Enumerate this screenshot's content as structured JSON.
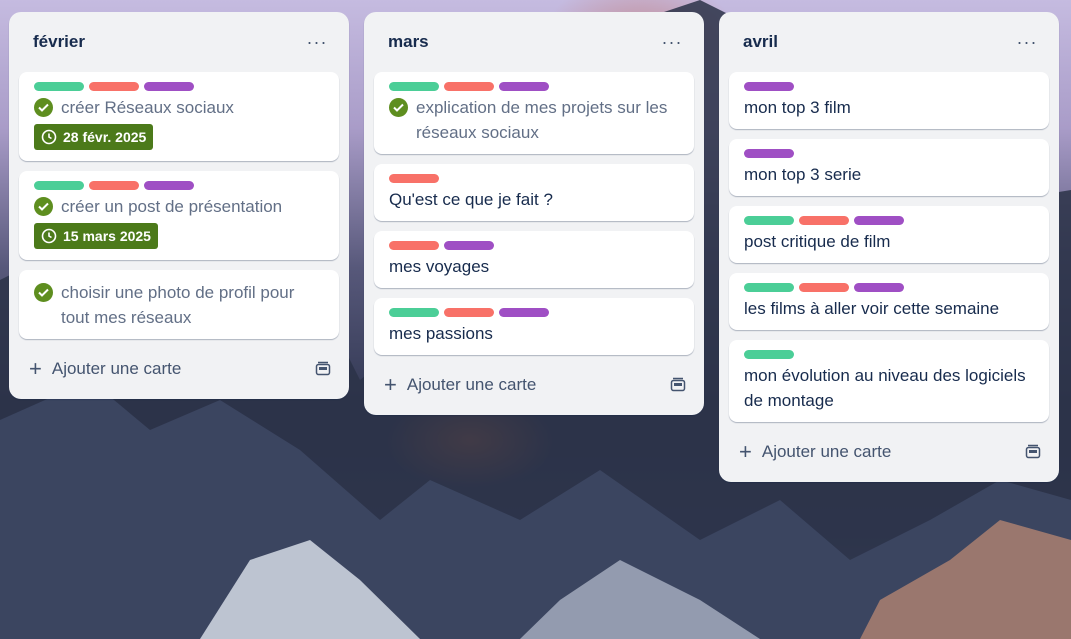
{
  "colors": {
    "green": "#4bce97",
    "red": "#f87168",
    "purple": "#9f4fc4",
    "due_bg": "#4c7a1a",
    "check_bg": "#5e8e1f"
  },
  "board": {
    "lists": [
      {
        "title": "février",
        "more_icon": "ellipsis-icon",
        "add_label": "Ajouter une carte",
        "cards": [
          {
            "labels": [
              "green",
              "red",
              "purple"
            ],
            "done": true,
            "title": "créer Réseaux sociaux",
            "due": "28 févr. 2025"
          },
          {
            "labels": [
              "green",
              "red",
              "purple"
            ],
            "done": true,
            "title": "créer un post de présentation",
            "due": "15 mars 2025"
          },
          {
            "labels": [],
            "done": true,
            "title": "choisir une photo de profil pour tout mes réseaux"
          }
        ]
      },
      {
        "title": "mars",
        "more_icon": "ellipsis-icon",
        "add_label": "Ajouter une carte",
        "cards": [
          {
            "labels": [
              "green",
              "red",
              "purple"
            ],
            "done": true,
            "title": "explication de mes projets sur les réseaux sociaux"
          },
          {
            "labels": [
              "red"
            ],
            "title": "Qu'est ce que je fait ?"
          },
          {
            "labels": [
              "red",
              "purple"
            ],
            "title": "mes voyages"
          },
          {
            "labels": [
              "green",
              "red",
              "purple"
            ],
            "title": "mes passions"
          }
        ]
      },
      {
        "title": "avril",
        "more_icon": "ellipsis-icon",
        "add_label": "Ajouter une carte",
        "cards": [
          {
            "labels": [
              "purple"
            ],
            "title": "mon top 3 film"
          },
          {
            "labels": [
              "purple"
            ],
            "title": "mon top 3 serie"
          },
          {
            "labels": [
              "green",
              "red",
              "purple"
            ],
            "title": "post critique de film"
          },
          {
            "labels": [
              "green",
              "red",
              "purple"
            ],
            "title": "les films à aller voir cette semaine"
          },
          {
            "labels": [
              "green"
            ],
            "title": "mon évolution au niveau des logiciels de montage"
          }
        ]
      }
    ]
  }
}
